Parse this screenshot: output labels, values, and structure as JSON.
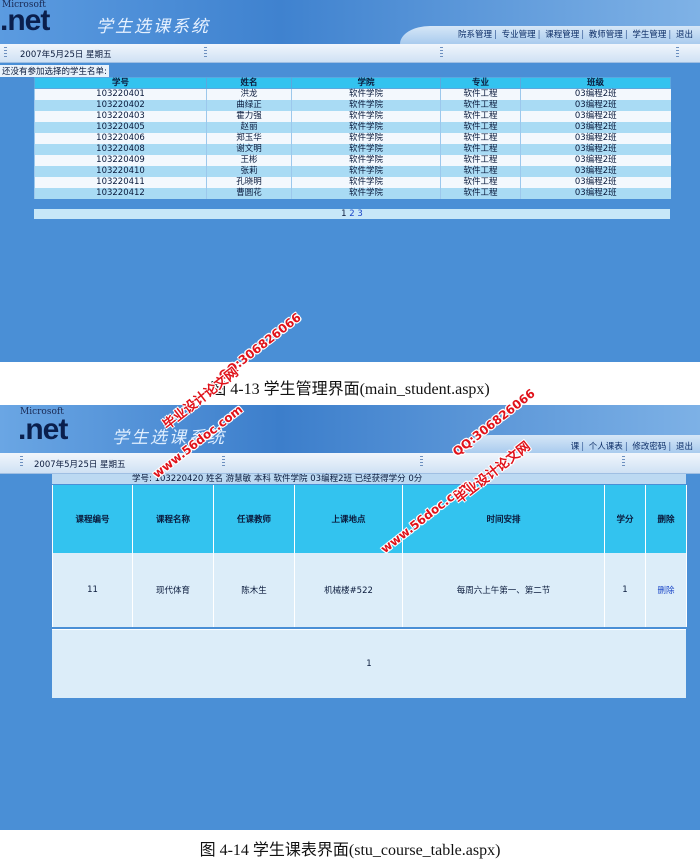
{
  "screen1": {
    "logo_small": "Microsoft",
    "logo": ".net",
    "app_title": "学生选课系统",
    "nav": [
      "院系管理",
      "专业管理",
      "课程管理",
      "教师管理",
      "学生管理",
      "退出"
    ],
    "date": "2007年5月25日  星期五",
    "notice": "还没有参加选择的学生名单:",
    "columns": [
      "学号",
      "姓名",
      "学院",
      "专业",
      "班级"
    ],
    "rows": [
      [
        "103220401",
        "洪龙",
        "软件学院",
        "软件工程",
        "03编程2班"
      ],
      [
        "103220402",
        "曲绿正",
        "软件学院",
        "软件工程",
        "03编程2班"
      ],
      [
        "103220403",
        "霍力强",
        "软件学院",
        "软件工程",
        "03编程2班"
      ],
      [
        "103220405",
        "赵丽",
        "软件学院",
        "软件工程",
        "03编程2班"
      ],
      [
        "103220406",
        "郑玉华",
        "软件学院",
        "软件工程",
        "03编程2班"
      ],
      [
        "103220408",
        "谢文明",
        "软件学院",
        "软件工程",
        "03编程2班"
      ],
      [
        "103220409",
        "王彬",
        "软件学院",
        "软件工程",
        "03编程2班"
      ],
      [
        "103220410",
        "张莉",
        "软件学院",
        "软件工程",
        "03编程2班"
      ],
      [
        "103220411",
        "孔晓明",
        "软件学院",
        "软件工程",
        "03编程2班"
      ],
      [
        "103220412",
        "曹圆花",
        "软件学院",
        "软件工程",
        "03编程2班"
      ]
    ],
    "pages": [
      "1",
      "2",
      "3"
    ]
  },
  "caption1": "图 4-13    学生管理界面(main_student.aspx)",
  "screen2": {
    "logo_small": "Microsoft",
    "logo": ".net",
    "app_title": "学生选课系统",
    "nav": [
      "课",
      "个人课表",
      "修改密码",
      "退出"
    ],
    "date": "2007年5月25日  星期五",
    "student_info": "学号: 103220420 姓名 游慧敏  本科  软件学院  03编程2班  已经获得学分 0分",
    "columns": [
      "课程编号",
      "课程名称",
      "任课教师",
      "上课地点",
      "时间安排",
      "学分",
      "删除"
    ],
    "rows": [
      [
        "11",
        "现代体育",
        "陈木生",
        "机械楼#522",
        "每周六上午第一、第二节",
        "1",
        "删除"
      ]
    ],
    "page": "1"
  },
  "caption2": "图 4-14    学生课表界面(stu_course_table.aspx)",
  "watermarks": {
    "site": "www.56doc.com",
    "qq": "QQ:306826066",
    "name": "毕业设计论文网"
  }
}
